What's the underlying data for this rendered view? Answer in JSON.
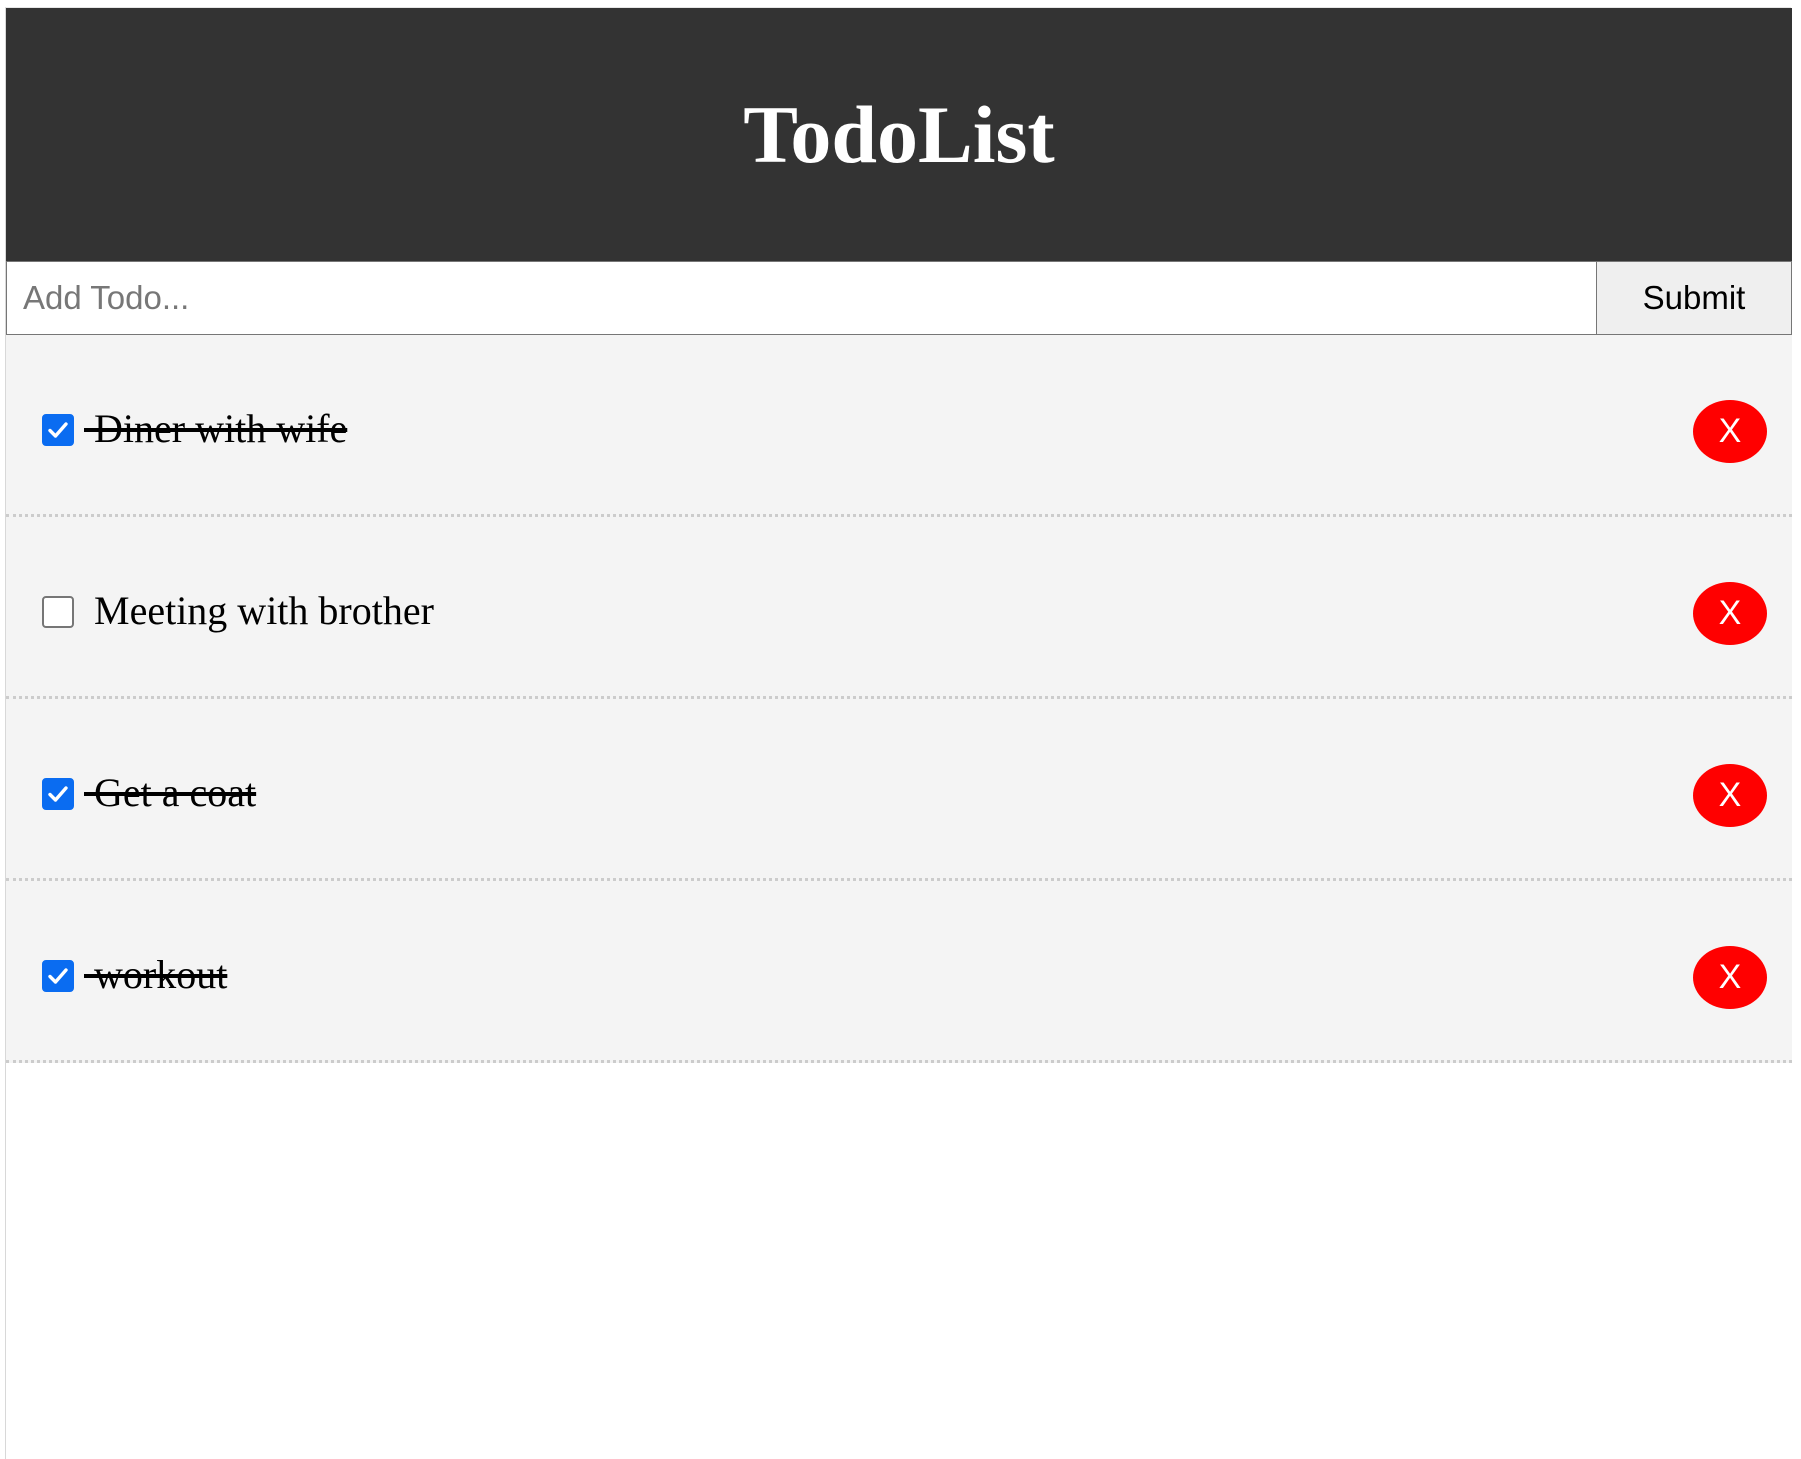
{
  "app": {
    "title": "TodoList"
  },
  "form": {
    "input_value": "",
    "input_placeholder": "Add Todo...",
    "submit_label": "Submit"
  },
  "todos": [
    {
      "text": " Diner with wife",
      "completed": true,
      "delete_label": "X"
    },
    {
      "text": " Meeting with brother",
      "completed": false,
      "delete_label": "X"
    },
    {
      "text": " Get a coat",
      "completed": true,
      "delete_label": "X"
    },
    {
      "text": " workout",
      "completed": true,
      "delete_label": "X"
    }
  ],
  "colors": {
    "header_bg": "#333333",
    "item_bg": "#f4f4f4",
    "delete_bg": "#ff0000",
    "checkbox_checked": "#0a6cf1"
  }
}
